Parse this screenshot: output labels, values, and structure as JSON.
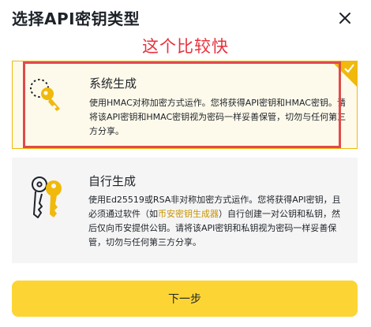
{
  "dialog": {
    "title": "选择API密钥类型",
    "annotation": "这个比较快"
  },
  "options": [
    {
      "title": "系统生成",
      "description": "使用HMAC对称加密方式运作。您将获得API密钥和HMAC密钥。请将该API密钥和HMAC密钥视为密码一样妥善保管，切勿与任何第三方分享。",
      "selected": true,
      "icon": "key-icon"
    },
    {
      "title": "自行生成",
      "description_before": "使用Ed25519或RSA非对称加密方式运作。您将获得API密钥，且必须通过软件（如",
      "description_link": "币安密钥生成器",
      "description_after": "）自行创建一对公钥和私钥，然后仅向币安提供公钥。请将该API密钥和私钥视为密码一样妥善保管，切勿与任何第三方分享。",
      "selected": false,
      "icon": "keys-icon"
    }
  ],
  "next_button": "下一步",
  "colors": {
    "accent": "#fcd535",
    "selected_border": "#f0b90b",
    "annotation": "#e8323c",
    "link": "#c99400"
  }
}
